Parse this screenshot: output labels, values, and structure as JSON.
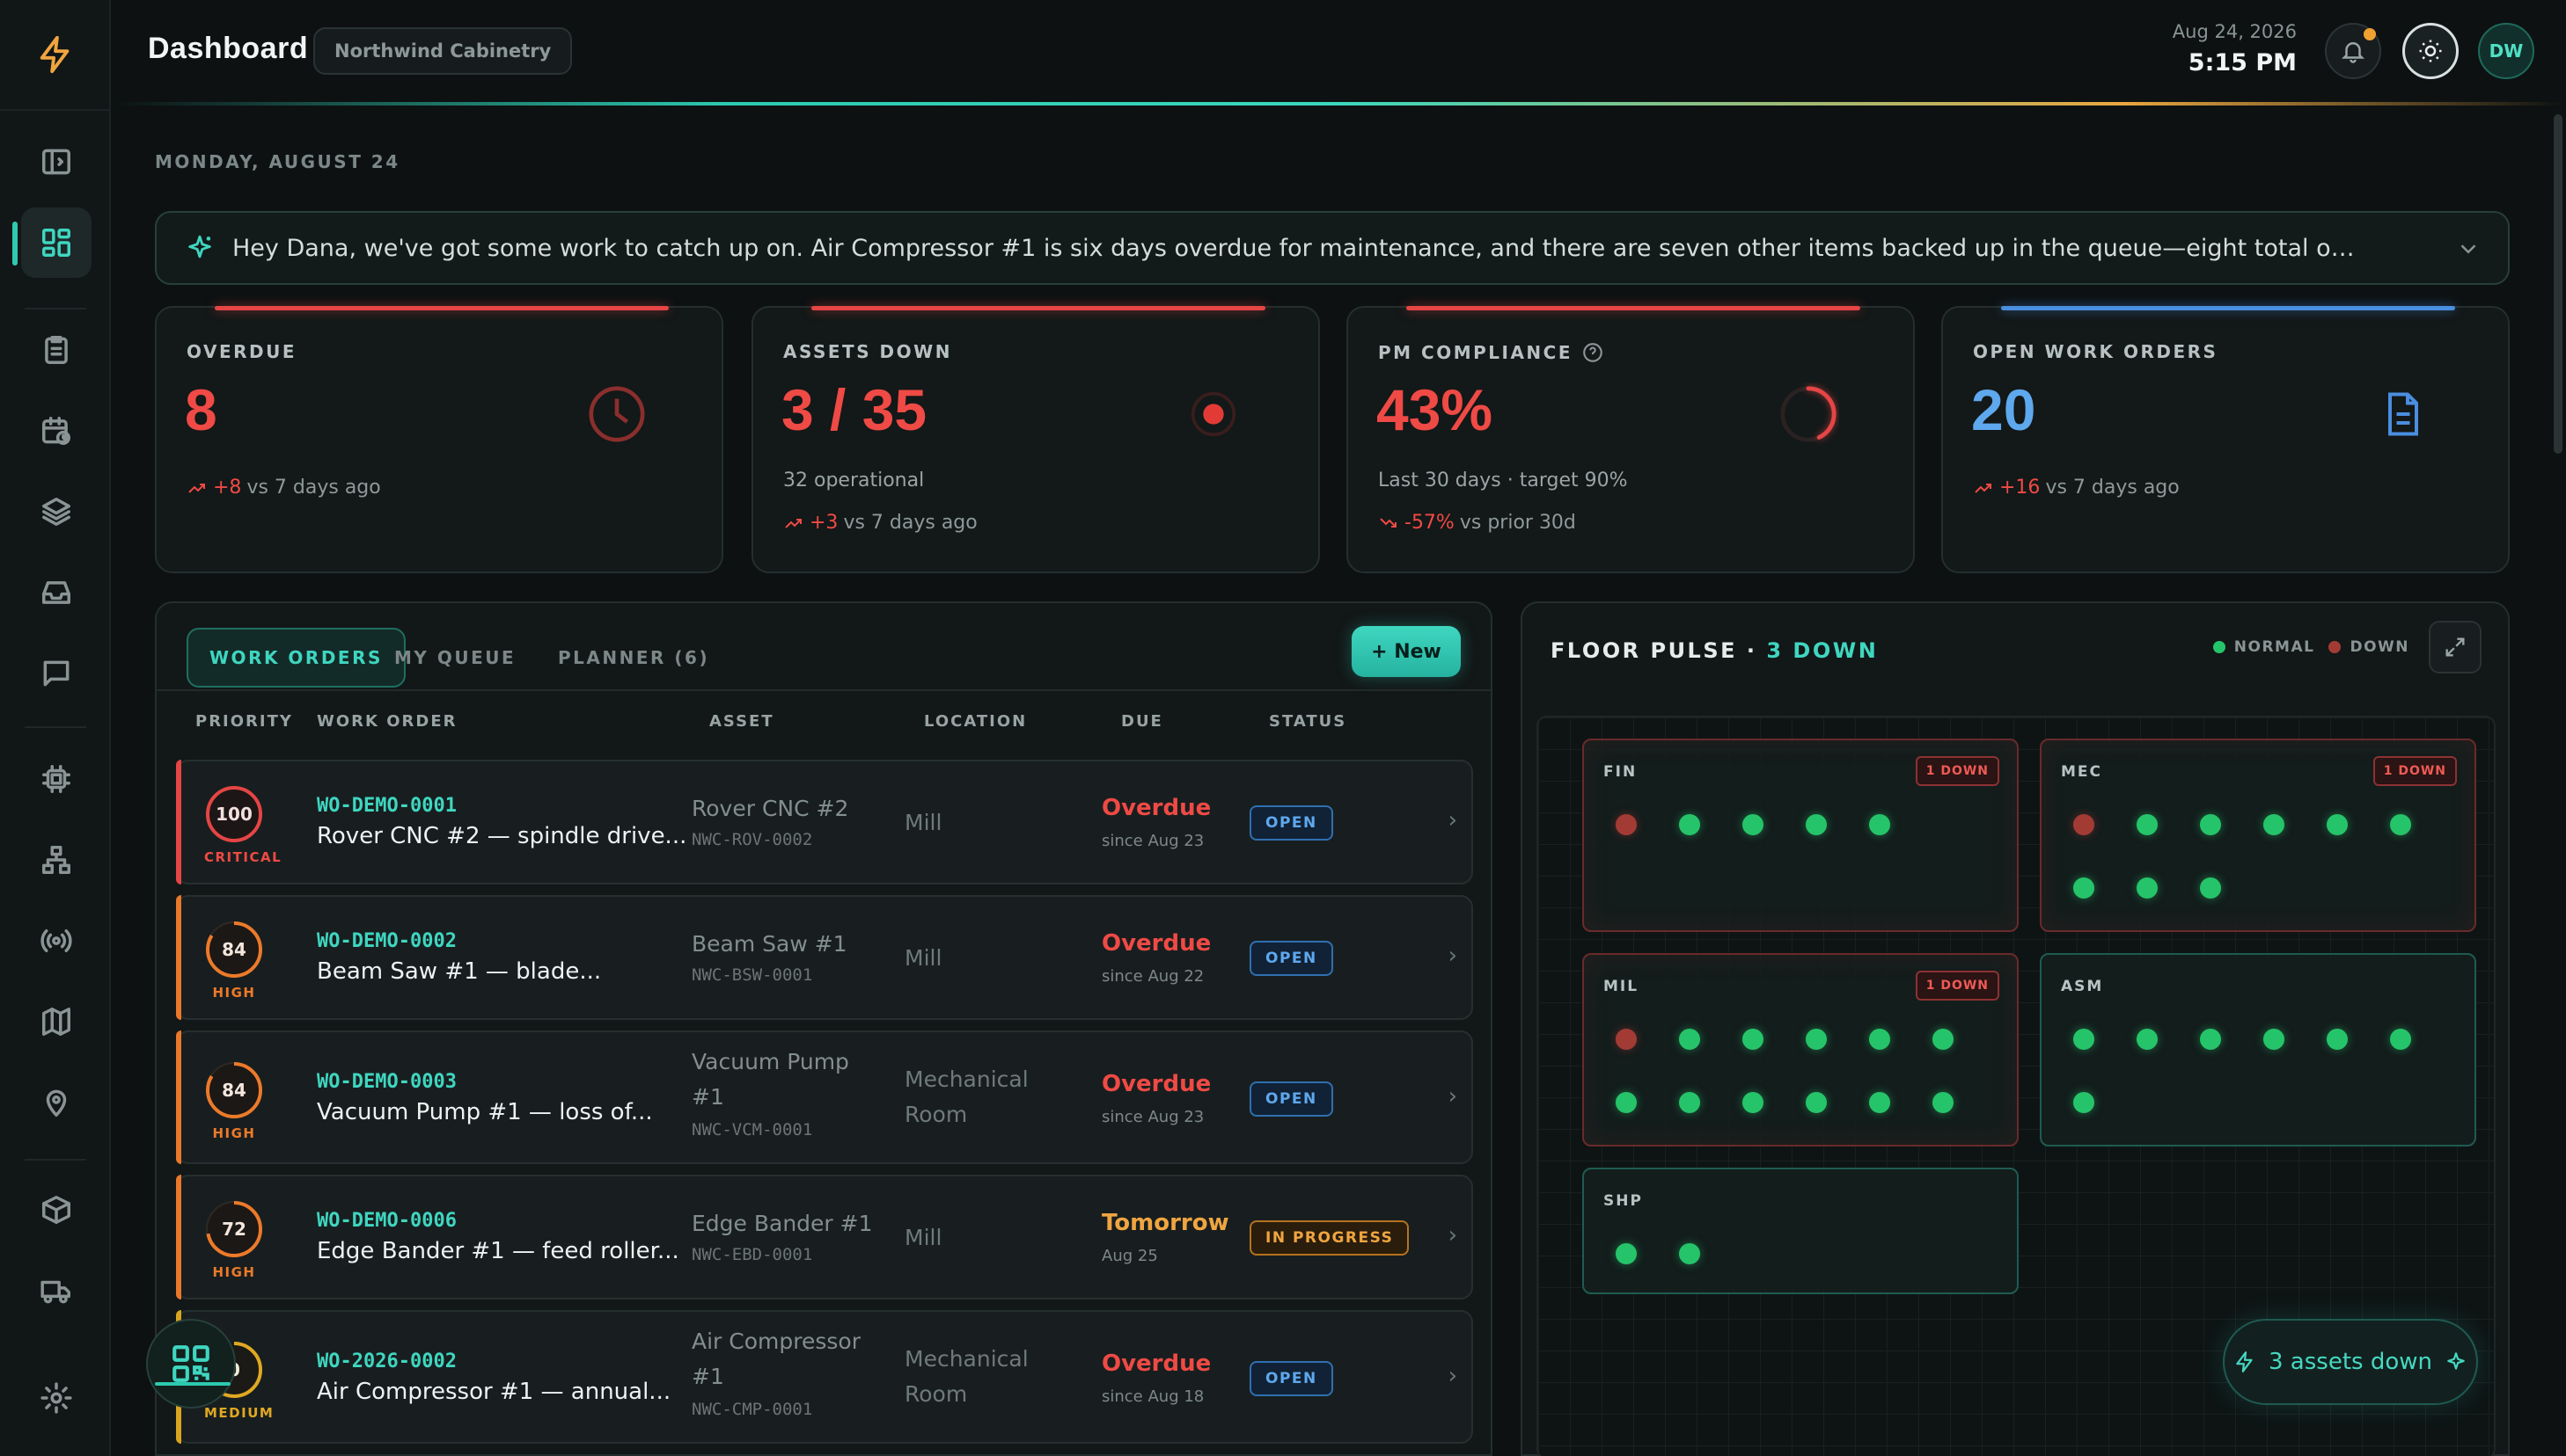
{
  "header": {
    "title": "Dashboard",
    "org": "Northwind Cabinetry",
    "date": "Aug 24, 2026",
    "time": "5:15 PM",
    "avatar_initials": "DW"
  },
  "date_label": "MONDAY, AUGUST 24",
  "banner": {
    "text": "Hey Dana, we've got some work to catch up on. Air Compressor #1 is six days overdue for maintenance, and there are seven other items backed up in the queue—eight total overdue right now. We also have..."
  },
  "kpis": {
    "overdue": {
      "label": "OVERDUE",
      "value": "8",
      "delta": "+8",
      "trend_text": "vs 7 days ago"
    },
    "assets_down": {
      "label": "ASSETS DOWN",
      "value": "3 / 35",
      "sub": "32 operational",
      "delta": "+3",
      "trend_text": "vs 7 days ago"
    },
    "pm": {
      "label": "PM COMPLIANCE",
      "value": "43%",
      "sub": "Last 30 days · target 90%",
      "delta": "-57%",
      "trend_text": "vs prior 30d",
      "fraction": 0.43
    },
    "open_wo": {
      "label": "OPEN WORK ORDERS",
      "value": "20",
      "delta": "+16",
      "trend_text": "vs 7 days ago"
    }
  },
  "work_orders": {
    "tabs": [
      "WORK ORDERS",
      "MY QUEUE",
      "PLANNER (6)"
    ],
    "new_label": "+ New",
    "columns": [
      "PRIORITY",
      "WORK ORDER",
      "ASSET",
      "LOCATION",
      "DUE",
      "STATUS"
    ],
    "rows": [
      {
        "score": "100",
        "priority": "CRITICAL",
        "id": "WO-DEMO-0001",
        "title": "Rover CNC #2 — spindle drive...",
        "asset": "Rover CNC #2",
        "asset_code": "NWC-ROV-0002",
        "location": "Mill",
        "due": "Overdue",
        "due_sub": "since Aug 23",
        "status": "OPEN"
      },
      {
        "score": "84",
        "priority": "HIGH",
        "id": "WO-DEMO-0002",
        "title": "Beam Saw #1 — blade...",
        "asset": "Beam Saw #1",
        "asset_code": "NWC-BSW-0001",
        "location": "Mill",
        "due": "Overdue",
        "due_sub": "since Aug 22",
        "status": "OPEN"
      },
      {
        "score": "84",
        "priority": "HIGH",
        "id": "WO-DEMO-0003",
        "title": "Vacuum Pump #1 — loss of...",
        "asset": "Vacuum Pump #1",
        "asset_code": "NWC-VCM-0001",
        "location": "Mechanical Room",
        "due": "Overdue",
        "due_sub": "since Aug 23",
        "status": "OPEN"
      },
      {
        "score": "72",
        "priority": "HIGH",
        "id": "WO-DEMO-0006",
        "title": "Edge Bander #1 — feed roller...",
        "asset": "Edge Bander #1",
        "asset_code": "NWC-EBD-0001",
        "location": "Mill",
        "due": "Tomorrow",
        "due_sub": "Aug 25",
        "status": "IN PROGRESS"
      },
      {
        "score": "0",
        "priority": "MEDIUM",
        "id": "WO-2026-0002",
        "title": "Air Compressor #1 — annual...",
        "asset": "Air Compressor #1",
        "asset_code": "NWC-CMP-0001",
        "location": "Mechanical Room",
        "due": "Overdue",
        "due_sub": "since Aug 18",
        "status": "OPEN"
      }
    ]
  },
  "floor_pulse": {
    "title": "FLOOR PULSE · ",
    "down_text": "3 DOWN",
    "legend_normal": "NORMAL",
    "legend_down": "DOWN",
    "zones": [
      {
        "name": "FIN",
        "badge": "1 DOWN",
        "machines": [
          "down",
          "up",
          "up",
          "up",
          "up"
        ]
      },
      {
        "name": "MEC",
        "badge": "1 DOWN",
        "machines": [
          "down",
          "up",
          "up",
          "up",
          "up",
          "up",
          "up",
          "up",
          "up"
        ]
      },
      {
        "name": "MIL",
        "badge": "1 DOWN",
        "machines": [
          "down",
          "up",
          "up",
          "up",
          "up",
          "up",
          "up",
          "up",
          "up",
          "up",
          "up",
          "up"
        ]
      },
      {
        "name": "ASM",
        "badge": "",
        "machines": [
          "up",
          "up",
          "up",
          "up",
          "up",
          "up",
          "up"
        ]
      },
      {
        "name": "SHP",
        "badge": "",
        "machines": [
          "up",
          "up"
        ]
      }
    ]
  },
  "assets_down_pill": "3 assets down",
  "colors": {
    "accent": "#3fd6c0",
    "danger": "#ef4a45",
    "warning": "#f0a540",
    "info": "#5ea8ee",
    "ok": "#26c46a"
  },
  "icons": [
    "bolt-icon",
    "sidebar-toggle-icon",
    "dashboard-icon",
    "clipboard-icon",
    "calendar-icon",
    "layers-icon",
    "inbox-icon",
    "chat-icon",
    "cpu-icon",
    "org-chart-icon",
    "broadcast-icon",
    "map-icon",
    "location-pin-icon",
    "box-icon",
    "truck-icon",
    "settings-icon",
    "bell-icon",
    "sun-icon",
    "clock-icon",
    "record-icon",
    "document-icon",
    "sparkle-icon",
    "chevron-down-icon",
    "expand-icon",
    "qr-code-icon"
  ]
}
